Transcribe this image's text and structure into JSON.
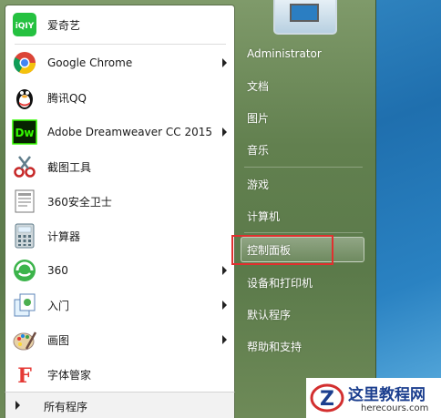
{
  "start_menu": {
    "programs": [
      {
        "label": "爱奇艺",
        "icon": "iqiyi-icon",
        "has_submenu": false
      },
      {
        "label": "Google Chrome",
        "icon": "chrome-icon",
        "has_submenu": true
      },
      {
        "label": "腾讯QQ",
        "icon": "qq-penguin-icon",
        "has_submenu": false
      },
      {
        "label": "Adobe Dreamweaver CC 2015",
        "icon": "dreamweaver-icon",
        "has_submenu": true
      },
      {
        "label": "截图工具",
        "icon": "snipping-tool-icon",
        "has_submenu": false
      },
      {
        "label": "360安全卫士",
        "icon": "360-safe-icon",
        "has_submenu": false
      },
      {
        "label": "计算器",
        "icon": "calculator-icon",
        "has_submenu": false
      },
      {
        "label": "360",
        "icon": "360-icon",
        "has_submenu": true
      },
      {
        "label": "入门",
        "icon": "getting-started-icon",
        "has_submenu": true
      },
      {
        "label": "画图",
        "icon": "paint-icon",
        "has_submenu": true
      },
      {
        "label": "字体管家",
        "icon": "font-manager-icon",
        "has_submenu": false
      }
    ],
    "all_programs": "所有程序",
    "right_items": [
      {
        "label": "Administrator"
      },
      {
        "label": "文档"
      },
      {
        "label": "图片"
      },
      {
        "label": "音乐"
      },
      {
        "label": "游戏"
      },
      {
        "label": "计算机"
      },
      {
        "label": "控制面板",
        "highlighted": true
      },
      {
        "label": "设备和打印机"
      },
      {
        "label": "默认程序"
      },
      {
        "label": "帮助和支持"
      }
    ]
  },
  "watermark": {
    "title": "这里教程网",
    "url": "herecours.com"
  },
  "colors": {
    "menu_bg": "#62804f",
    "highlight_border": "#e0302f",
    "desktop": "#2a82c2"
  }
}
